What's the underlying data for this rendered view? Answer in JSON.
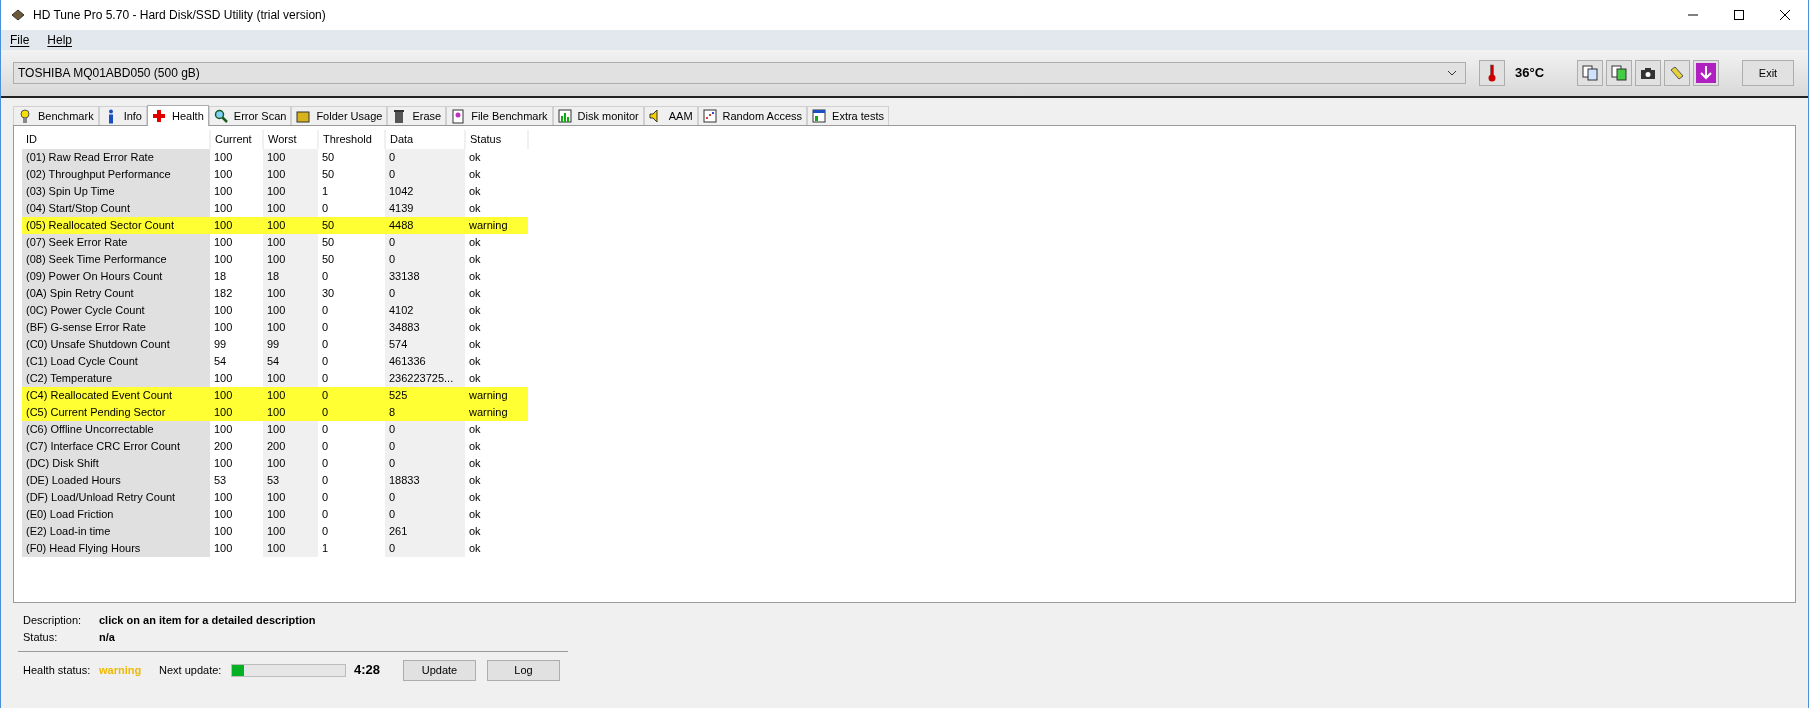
{
  "window": {
    "title": "HD Tune Pro 5.70 - Hard Disk/SSD Utility (trial version)"
  },
  "menu": [
    "File",
    "Help"
  ],
  "toolbar": {
    "drive": "TOSHIBA MQ01ABD050 (500 gB)",
    "temperature": "36°C",
    "exit": "Exit"
  },
  "tabs": [
    {
      "label": "Benchmark",
      "selected": false
    },
    {
      "label": "Info",
      "selected": false
    },
    {
      "label": "Health",
      "selected": true
    },
    {
      "label": "Error Scan",
      "selected": false
    },
    {
      "label": "Folder Usage",
      "selected": false
    },
    {
      "label": "Erase",
      "selected": false
    },
    {
      "label": "File Benchmark",
      "selected": false
    },
    {
      "label": "Disk monitor",
      "selected": false
    },
    {
      "label": "AAM",
      "selected": false
    },
    {
      "label": "Random Access",
      "selected": false
    },
    {
      "label": "Extra tests",
      "selected": false
    }
  ],
  "table": {
    "columns": [
      "ID",
      "Current",
      "Worst",
      "Threshold",
      "Data",
      "Status"
    ],
    "rows": [
      {
        "cells": [
          "(01) Raw Read Error Rate",
          "100",
          "100",
          "50",
          "0",
          "ok"
        ],
        "highlighted": false
      },
      {
        "cells": [
          "(02) Throughput Performance",
          "100",
          "100",
          "50",
          "0",
          "ok"
        ],
        "highlighted": false
      },
      {
        "cells": [
          "(03) Spin Up Time",
          "100",
          "100",
          "1",
          "1042",
          "ok"
        ],
        "highlighted": false
      },
      {
        "cells": [
          "(04) Start/Stop Count",
          "100",
          "100",
          "0",
          "4139",
          "ok"
        ],
        "highlighted": false
      },
      {
        "cells": [
          "(05) Reallocated Sector Count",
          "100",
          "100",
          "50",
          "4488",
          "warning"
        ],
        "highlighted": true
      },
      {
        "cells": [
          "(07) Seek Error Rate",
          "100",
          "100",
          "50",
          "0",
          "ok"
        ],
        "highlighted": false
      },
      {
        "cells": [
          "(08) Seek Time Performance",
          "100",
          "100",
          "50",
          "0",
          "ok"
        ],
        "highlighted": false
      },
      {
        "cells": [
          "(09) Power On Hours Count",
          "18",
          "18",
          "0",
          "33138",
          "ok"
        ],
        "highlighted": false
      },
      {
        "cells": [
          "(0A) Spin Retry Count",
          "182",
          "100",
          "30",
          "0",
          "ok"
        ],
        "highlighted": false
      },
      {
        "cells": [
          "(0C) Power Cycle Count",
          "100",
          "100",
          "0",
          "4102",
          "ok"
        ],
        "highlighted": false
      },
      {
        "cells": [
          "(BF) G-sense Error Rate",
          "100",
          "100",
          "0",
          "34883",
          "ok"
        ],
        "highlighted": false
      },
      {
        "cells": [
          "(C0) Unsafe Shutdown Count",
          "99",
          "99",
          "0",
          "574",
          "ok"
        ],
        "highlighted": false
      },
      {
        "cells": [
          "(C1) Load Cycle Count",
          "54",
          "54",
          "0",
          "461336",
          "ok"
        ],
        "highlighted": false
      },
      {
        "cells": [
          "(C2) Temperature",
          "100",
          "100",
          "0",
          "236223725...",
          "ok"
        ],
        "highlighted": false
      },
      {
        "cells": [
          "(C4) Reallocated Event Count",
          "100",
          "100",
          "0",
          "525",
          "warning"
        ],
        "highlighted": true
      },
      {
        "cells": [
          "(C5) Current Pending Sector",
          "100",
          "100",
          "0",
          "8",
          "warning"
        ],
        "highlighted": true
      },
      {
        "cells": [
          "(C6) Offline Uncorrectable",
          "100",
          "100",
          "0",
          "0",
          "ok"
        ],
        "highlighted": false
      },
      {
        "cells": [
          "(C7) Interface CRC Error Count",
          "200",
          "200",
          "0",
          "0",
          "ok"
        ],
        "highlighted": false
      },
      {
        "cells": [
          "(DC) Disk Shift",
          "100",
          "100",
          "0",
          "0",
          "ok"
        ],
        "highlighted": false
      },
      {
        "cells": [
          "(DE) Loaded Hours",
          "53",
          "53",
          "0",
          "18833",
          "ok"
        ],
        "highlighted": false
      },
      {
        "cells": [
          "(DF) Load/Unload Retry Count",
          "100",
          "100",
          "0",
          "0",
          "ok"
        ],
        "highlighted": false
      },
      {
        "cells": [
          "(E0) Load Friction",
          "100",
          "100",
          "0",
          "0",
          "ok"
        ],
        "highlighted": false
      },
      {
        "cells": [
          "(E2) Load-in time",
          "100",
          "100",
          "0",
          "261",
          "ok"
        ],
        "highlighted": false
      },
      {
        "cells": [
          "(F0) Head Flying Hours",
          "100",
          "100",
          "1",
          "0",
          "ok"
        ],
        "highlighted": false
      }
    ]
  },
  "details": {
    "description_label": "Description:",
    "description": "click on an item for a detailed description",
    "status_label": "Status:",
    "status": "n/a"
  },
  "health": {
    "label": "Health status:",
    "value": "warning",
    "next_update_label": "Next update:",
    "level": 0.11,
    "countdown": "4:28",
    "buttons": [
      "Update",
      "Log"
    ]
  }
}
